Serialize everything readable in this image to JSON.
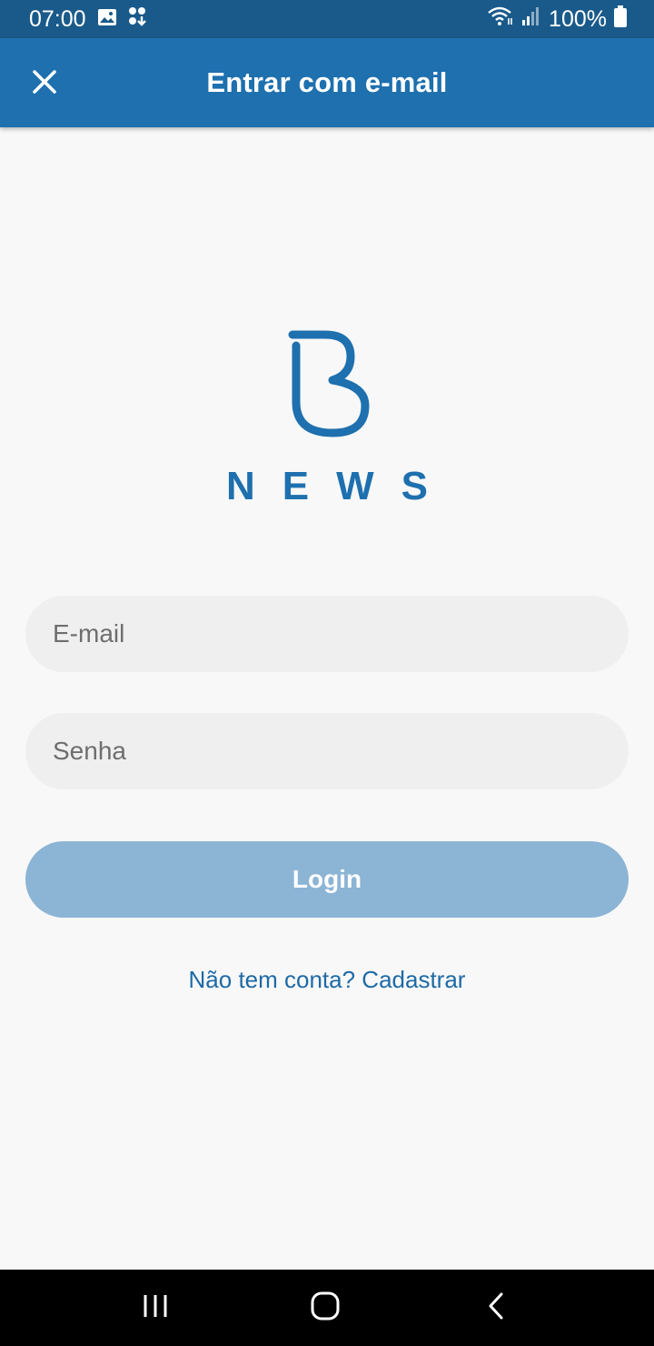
{
  "status_bar": {
    "time": "07:00",
    "battery": "100%",
    "icons": [
      "gallery-icon",
      "download-icon",
      "wifi-icon",
      "signal-icon",
      "battery-icon"
    ]
  },
  "app_bar": {
    "title": "Entrar com e-mail",
    "close_icon": "close-icon"
  },
  "brand": {
    "logo_icon": "b-logo-icon",
    "wordmark": "NEWS"
  },
  "form": {
    "email_placeholder": "E-mail",
    "email_value": "",
    "password_placeholder": "Senha",
    "password_value": "",
    "login_label": "Login",
    "signup_text": "Não tem conta? Cadastrar"
  },
  "nav_bar": {
    "icons": [
      "recent-apps-icon",
      "home-icon",
      "back-icon"
    ]
  },
  "colors": {
    "primary": "#1e70ae",
    "status_bar": "#1a5a8a",
    "login_disabled": "#8cb4d5",
    "field_bg": "#efefef",
    "background": "#f8f8f8"
  }
}
